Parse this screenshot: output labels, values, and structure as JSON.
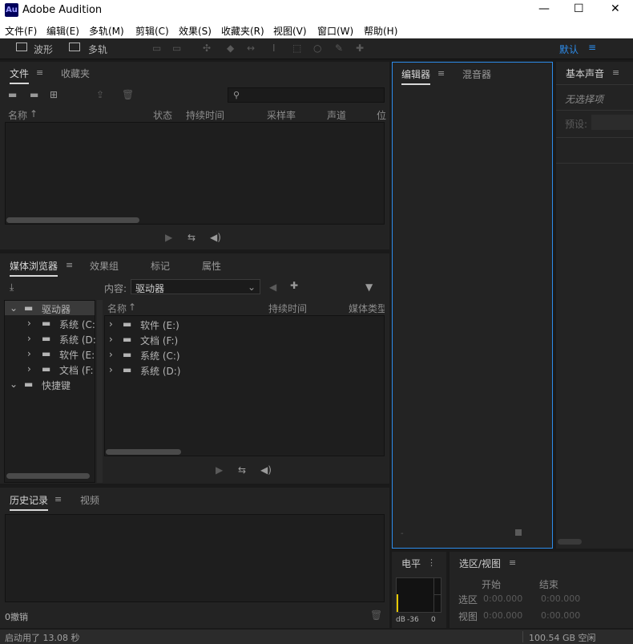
{
  "app": {
    "logo": "Au",
    "title": "Adobe Audition"
  },
  "window_controls": {
    "minimize": "—",
    "maximize": "☐",
    "close": "✕"
  },
  "menu": [
    "文件(F)",
    "编辑(E)",
    "多轨(M)",
    "剪辑(C)",
    "效果(S)",
    "收藏夹(R)",
    "视图(V)",
    "窗口(W)",
    "帮助(H)"
  ],
  "toolbar": {
    "waveform": "波形",
    "multitrack": "多轨",
    "workspace": "默认"
  },
  "files_panel": {
    "tabs": [
      "文件",
      "收藏夹"
    ],
    "columns": [
      "名称",
      "状态",
      "持续时间",
      "采样率",
      "声道",
      "位"
    ]
  },
  "media_panel": {
    "tabs": [
      "媒体浏览器",
      "效果组",
      "标记",
      "属性"
    ],
    "content_label": "内容:",
    "content_value": "驱动器",
    "tree": [
      {
        "label": "驱动器",
        "level": 0
      },
      {
        "label": "系统 (C:",
        "level": 1
      },
      {
        "label": "系统 (D:",
        "level": 1
      },
      {
        "label": "软件 (E:",
        "level": 1
      },
      {
        "label": "文档 (F:",
        "level": 1
      },
      {
        "label": "快捷键",
        "level": 0
      }
    ],
    "columns": [
      "名称",
      "持续时间",
      "媒体类型"
    ],
    "items": [
      "软件 (E:)",
      "文档 (F:)",
      "系统 (C:)",
      "系统 (D:)"
    ]
  },
  "history_panel": {
    "tabs": [
      "历史记录",
      "视频"
    ],
    "undo_count": "0撤销"
  },
  "editor_panel": {
    "tabs": [
      "编辑器",
      "混音器"
    ]
  },
  "essential_sound": {
    "title": "基本声音",
    "no_selection": "无选择项",
    "preset_label": "预设:"
  },
  "level_panel": {
    "title": "电平",
    "db_label": "dB",
    "ticks": [
      "-36",
      "0"
    ]
  },
  "selection_panel": {
    "title": "选区/视图",
    "start_label": "开始",
    "end_label": "结束",
    "rows": [
      {
        "label": "选区",
        "start": "0:00.000",
        "end": "0:00.000"
      },
      {
        "label": "视图",
        "start": "0:00.000",
        "end": "0:00.000"
      }
    ]
  },
  "status": {
    "startup": "启动用了 13.08 秒",
    "disk": "100.54 GB 空闲"
  }
}
